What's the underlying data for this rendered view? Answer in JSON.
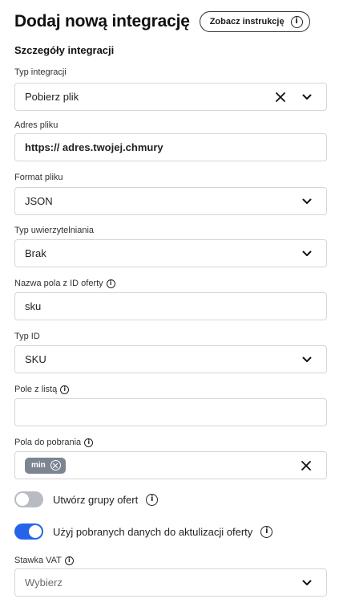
{
  "header": {
    "title": "Dodaj nową integrację",
    "instructions_button": "Zobacz instrukcję"
  },
  "section_title": "Szczegóły integracji",
  "fields": {
    "integration_type": {
      "label": "Typ integracji",
      "value": "Pobierz plik"
    },
    "file_address": {
      "label": "Adres pliku",
      "value": "https:// adres.twojej.chmury"
    },
    "file_format": {
      "label": "Format pliku",
      "value": "JSON"
    },
    "auth_type": {
      "label": "Typ uwierzytelniania",
      "value": "Brak"
    },
    "offer_id_field": {
      "label": "Nazwa pola z ID oferty",
      "value": "sku"
    },
    "id_type": {
      "label": "Typ ID",
      "value": "SKU"
    },
    "list_field": {
      "label": "Pole z listą",
      "value": ""
    },
    "fields_to_fetch": {
      "label": "Pola do pobrania",
      "tags": [
        "min"
      ]
    },
    "vat_rate": {
      "label": "Stawka VAT",
      "placeholder": "Wybierz"
    }
  },
  "toggles": {
    "create_offer_groups": {
      "label": "Utwórz grupy ofert",
      "state": "off"
    },
    "use_fetched_data": {
      "label": "Użyj pobranych danych do aktulizacji oferty",
      "state": "on"
    }
  },
  "icons": {
    "info": "info-circle-icon",
    "chevron": "chevron-down-icon",
    "clear": "close-icon"
  },
  "colors": {
    "toggle_on": "#2563eb",
    "toggle_off": "#b8bcc2",
    "tag_bg": "#7c8591",
    "border": "#d6d6d6"
  }
}
